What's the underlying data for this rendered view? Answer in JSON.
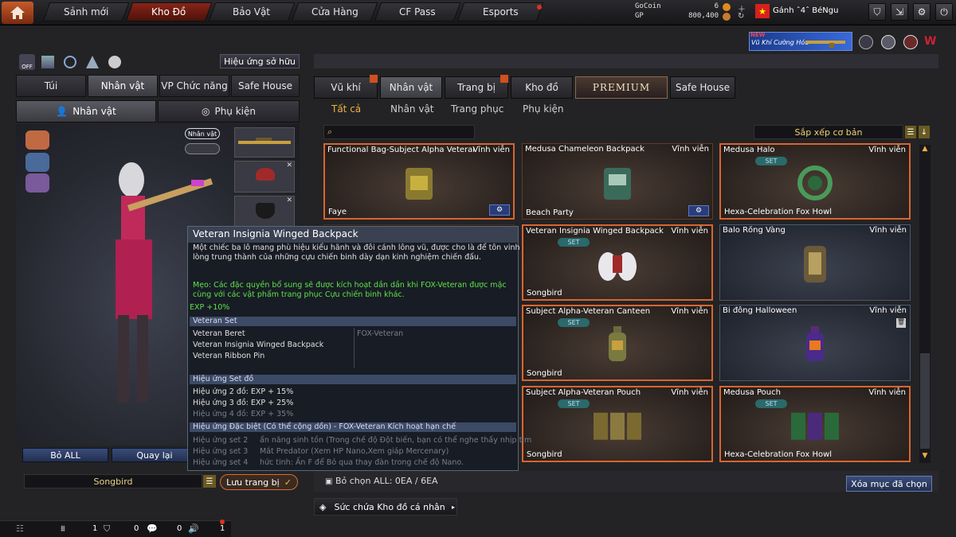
{
  "nav": {
    "tabs": [
      {
        "label": "Sảnh mới"
      },
      {
        "label": "Kho Đồ",
        "active": true
      },
      {
        "label": "Bảo Vật"
      },
      {
        "label": "Cửa Hàng"
      },
      {
        "label": "CF Pass"
      },
      {
        "label": "Esports"
      }
    ]
  },
  "currency": {
    "gocoin_label": "GoCoin",
    "gocoin_value": "6",
    "gp_label": "GP",
    "gp_value": "800,400"
  },
  "user": {
    "name": "Gánh ˆ4ˆ BéNgu"
  },
  "banner": {
    "new": "NEW",
    "text": "Vũ Khí Cường Hóa"
  },
  "left": {
    "effect_btn": "Hiệu ứng sở hữu",
    "tabs": [
      "Túi",
      "Nhân vật",
      "VP Chức năng",
      "Safe House"
    ],
    "subtabs": [
      "Nhân vật",
      "Phụ kiện"
    ],
    "badge": "Nhân vật",
    "btn_all": "Bỏ ALL",
    "btn_back": "Quay lại",
    "char_name": "Songbird",
    "save_btn": "Lưu trang bị"
  },
  "right": {
    "tabs": [
      "Vũ khí",
      "Nhân vật",
      "Trang bị",
      "Kho đồ",
      "PREMIUM",
      "Safe House"
    ],
    "filters": [
      "Tất cả",
      "Nhân vật",
      "Trang phục",
      "Phụ kiện"
    ],
    "search_placeholder": "",
    "sort": "Sắp xếp cơ bản",
    "deselect": "Bỏ chọn ALL: 0EA / 6EA",
    "delete_btn": "Xóa mục đã chọn",
    "storage": "Sức chứa Kho đồ cá nhân"
  },
  "items": [
    {
      "name": "Functional Bag-Subject Alpha Veteran",
      "dur": "Vĩnh viễn",
      "bottom": "Faye",
      "set": "",
      "gear": true
    },
    {
      "name": "Medusa Chameleon Backpack",
      "dur": "Vĩnh viễn",
      "bottom": "Beach Party",
      "set": "",
      "gear": true
    },
    {
      "name": "Medusa Halo",
      "dur": "Vĩnh viễn",
      "bottom": "Hexa-Celebration Fox Howl",
      "set": "SET",
      "gear": false
    },
    {
      "name": "Veteran Insignia Winged Backpack",
      "dur": "Vĩnh viễn",
      "bottom": "Songbird",
      "set": "SET",
      "gear": false
    },
    {
      "name": "Balo Rồng Vàng",
      "dur": "Vĩnh viễn",
      "bottom": "",
      "set": "",
      "gear": false
    },
    {
      "name": "Subject Alpha-Veteran Canteen",
      "dur": "Vĩnh viễn",
      "bottom": "Songbird",
      "set": "SET",
      "gear": false
    },
    {
      "name": "Bi đông Halloween",
      "dur": "Vĩnh viễn",
      "bottom": "",
      "set": "",
      "gear": false
    },
    {
      "name": "Subject Alpha-Veteran Pouch",
      "dur": "Vĩnh viễn",
      "bottom": "Songbird",
      "set": "SET",
      "gear": false
    },
    {
      "name": "Medusa Pouch",
      "dur": "Vĩnh viễn",
      "bottom": "Hexa-Celebration Fox Howl",
      "set": "SET",
      "gear": false
    }
  ],
  "tooltip": {
    "title": "Veteran Insignia Winged Backpack",
    "desc1": "Một chiếc ba lô mang phù hiệu kiểu hãnh và đôi cánh lông vũ, được cho là để tôn vinh",
    "desc2": "lòng trung thành của những cựu chiến binh dày dạn kinh nghiệm chiến đấu.",
    "tip1": "Mẹo: Các đặc quyền bổ sung sẽ được kích hoạt dần dần khi FOX-Veteran được mặc",
    "tip2": "cùng với các vật phẩm trang phục Cựu chiến binh khác.",
    "exp": "EXP +10%",
    "set_header": "Veteran Set",
    "set_items": [
      "Veteran Beret",
      "Veteran Insignia Winged Backpack",
      "Veteran Ribbon Pin"
    ],
    "set_char": "FOX-Veteran",
    "effect_header": "Hiệu ứng Set đồ",
    "effects": [
      "Hiệu ứng 2 đồ: EXP + 15%",
      "Hiệu ứng 3 đồ: EXP + 25%",
      "Hiệu ứng 4 đồ: EXP + 35%"
    ],
    "special_header": "Hiệu ứng Đặc biệt (Có thể cộng dồn) - FOX-Veteran Kích hoạt hạn chế",
    "special": [
      {
        "k": "Hiệu ứng set 2",
        "v": "ẩn năng sinh tồn (Trong chế độ Đột biến, bạn có thể nghe thấy nhịp tim"
      },
      {
        "k": "Hiệu ứng set 3",
        "v": "Mắt Predator (Xem HP Nano,Xem giáp Mercenary)"
      },
      {
        "k": "Hiệu ứng set 4",
        "v": "hức tinh: Ấn F để Bỏ qua thay đàn trong chế độ Nano."
      }
    ]
  },
  "statusbar": {
    "c1": "1",
    "c2": "0",
    "c3": "0",
    "c4": "1"
  }
}
